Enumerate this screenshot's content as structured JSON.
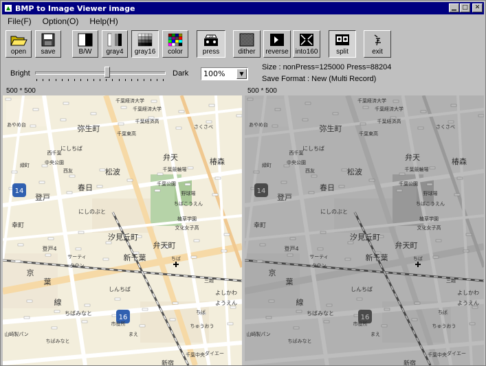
{
  "window": {
    "title": "BMP to Image Viewer image"
  },
  "menu": {
    "file": "File(F)",
    "option": "Option(O)",
    "help": "Help(H)"
  },
  "toolbar": {
    "open": "open",
    "save": "save",
    "bw": "B/W",
    "gray4": "gray4",
    "gray16": "gray16",
    "color": "color",
    "press": "press",
    "dither": "dither",
    "reverse": "reverse",
    "into160": "into160",
    "split": "split",
    "exit": "exit"
  },
  "slider": {
    "bright_label": "Bright",
    "dark_label": "Dark",
    "level_fraction": 0.55
  },
  "zoom": {
    "value": "100%"
  },
  "info": {
    "size": "Size : nonPress=125000  Press=88204",
    "format": "Save Format : New (Multi Record)"
  },
  "left_dims": "500 * 500",
  "right_dims": "500 * 500",
  "map": {
    "labels": [
      "千葉経済大学",
      "千葉経済大学",
      "千葉経済高",
      "千葉東高",
      "さくさべ",
      "弥生町",
      "あやめ台",
      "西千葉",
      "中央公園",
      "西友",
      "にしちば",
      "弁天",
      "千葉競輪場",
      "緑町",
      "松波",
      "千葉公園",
      "椿森",
      "登戸",
      "春日",
      "野球場",
      "ちばこうえん",
      "幸町",
      "にしのぶと",
      "植草学園",
      "文化女子高",
      "登戸4",
      "汐見丘町",
      "弁天町",
      "新千葉",
      "ちば",
      "サーティ",
      "タウン",
      "京",
      "葉",
      "線",
      "しんちば",
      "三越",
      "よしかわ",
      "ようえん",
      "山崎製パン",
      "ちばみなと",
      "市役所",
      "ちば",
      "ちゅうおう",
      "まえ",
      "ちばみなと",
      "ダイエー",
      "新宿",
      "千葉中央"
    ],
    "routes": [
      "14",
      "16"
    ]
  }
}
